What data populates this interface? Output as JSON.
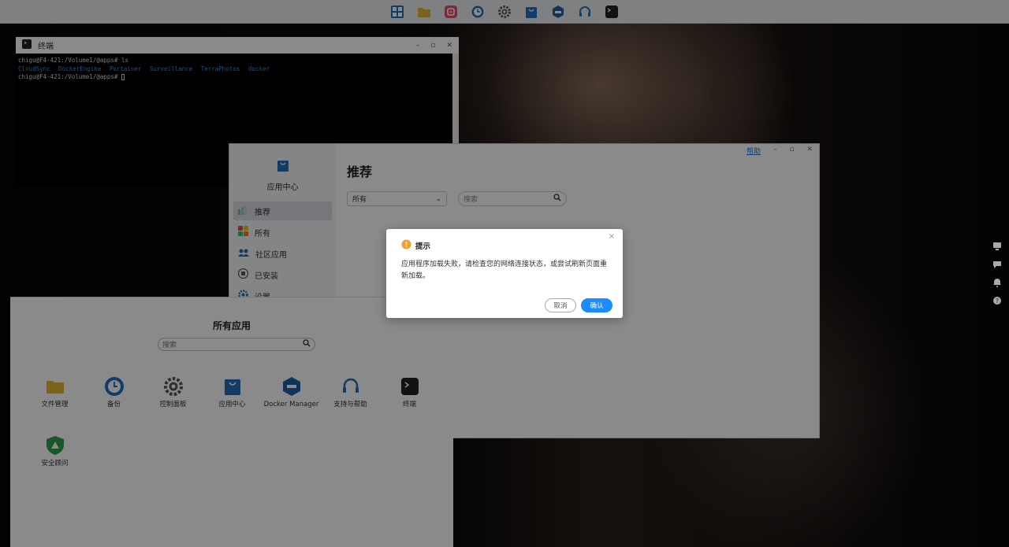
{
  "colors": {
    "accent": "#1a8cff",
    "warning": "#f0a030",
    "link": "#1a73e8",
    "terminal_list": "#3b8ef0"
  },
  "taskbar": {
    "icons": [
      "app-grid-icon",
      "file-manager-icon",
      "photos-icon",
      "backup-icon",
      "control-panel-icon",
      "app-center-icon",
      "docker-icon",
      "support-icon",
      "terminal-icon"
    ]
  },
  "side_icons": [
    "remote-desktop-icon",
    "chat-icon",
    "notification-bell-icon",
    "help-icon"
  ],
  "terminal": {
    "title": "终端",
    "line1": "chigu@F4-421:/Volume1/@apps# ls",
    "listing": [
      "CloudSync",
      "DockerEngine",
      "Portainer",
      "Surveillance",
      "TerraPhotos",
      "docker"
    ],
    "line3": "chigu@F4-421:/Volume1/@apps#",
    "controls": [
      "–",
      "▫",
      "✕"
    ]
  },
  "app_center": {
    "logo_label": "应用中心",
    "title": "推荐",
    "help_link": "帮助",
    "controls": [
      "–",
      "▫",
      "✕"
    ],
    "nav": [
      {
        "label": "推荐",
        "icon": "recommend-icon",
        "active": true
      },
      {
        "label": "所有",
        "icon": "all-apps-icon",
        "active": false
      },
      {
        "label": "社区应用",
        "icon": "community-icon",
        "active": false
      },
      {
        "label": "已安装",
        "icon": "installed-icon",
        "active": false
      },
      {
        "label": "设置",
        "icon": "settings-gear-icon",
        "active": false
      }
    ],
    "filter_select": {
      "value": "所有"
    },
    "search": {
      "placeholder": "搜索"
    }
  },
  "all_apps": {
    "title": "所有应用",
    "search": {
      "placeholder": "搜索"
    },
    "apps": [
      {
        "label": "文件管理",
        "icon": "folder-icon"
      },
      {
        "label": "备份",
        "icon": "backup-clock-icon"
      },
      {
        "label": "控制面板",
        "icon": "gear-icon"
      },
      {
        "label": "应用中心",
        "icon": "shopping-bag-icon"
      },
      {
        "label": "Docker Manager",
        "icon": "docker-icon"
      },
      {
        "label": "支持与帮助",
        "icon": "headset-icon"
      },
      {
        "label": "终端",
        "icon": "terminal-icon"
      },
      {
        "label": "安全顾问",
        "icon": "shield-icon"
      }
    ]
  },
  "dialog": {
    "title": "提示",
    "message": "应用程序加载失败，请检查您的网络连接状态，或尝试刷新页面重新加载。",
    "cancel_label": "取消",
    "ok_label": "确认",
    "close": "×"
  }
}
